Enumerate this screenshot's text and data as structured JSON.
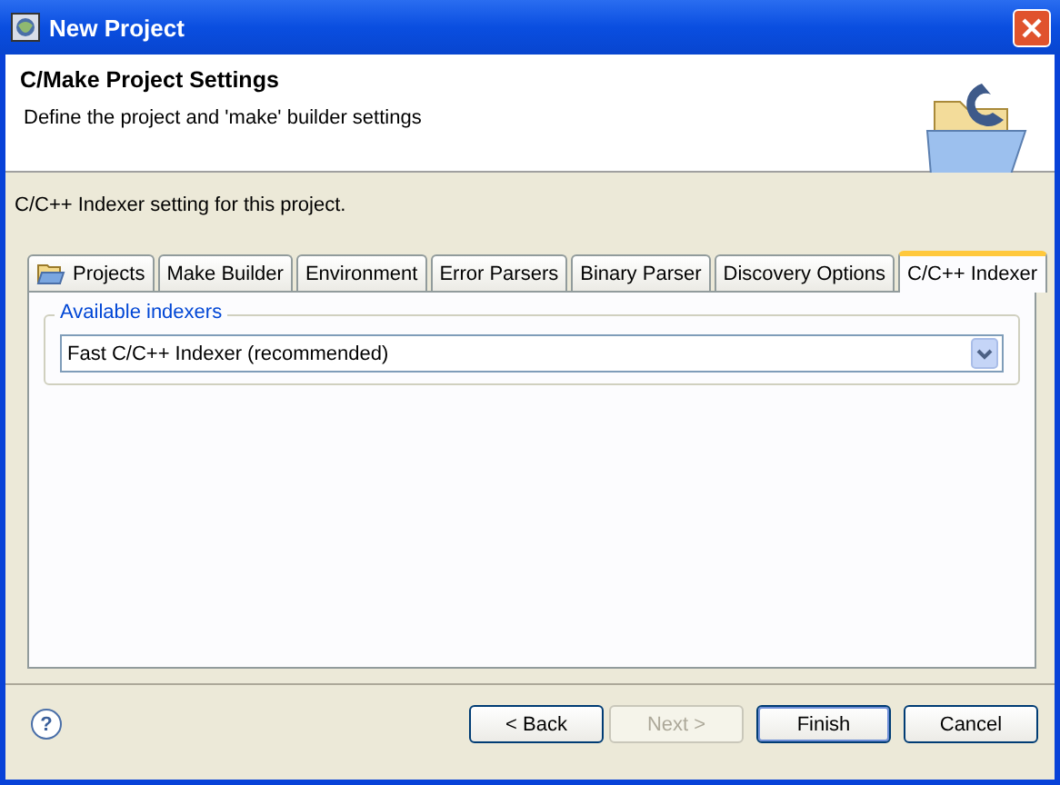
{
  "window": {
    "title": "New Project"
  },
  "header": {
    "title": "C/Make Project Settings",
    "description": "Define the project and 'make' builder settings"
  },
  "message": "C/C++ Indexer setting for this project.",
  "tabs": [
    {
      "label": "Projects",
      "selected": false,
      "icon": true
    },
    {
      "label": "Make Builder",
      "selected": false,
      "icon": false
    },
    {
      "label": "Environment",
      "selected": false,
      "icon": false
    },
    {
      "label": "Error Parsers",
      "selected": false,
      "icon": false
    },
    {
      "label": "Binary Parser",
      "selected": false,
      "icon": false
    },
    {
      "label": "Discovery Options",
      "selected": false,
      "icon": false
    },
    {
      "label": "C/C++ Indexer",
      "selected": true,
      "icon": false
    }
  ],
  "indexers": {
    "label": "Available indexers",
    "value": "Fast C/C++ Indexer (recommended)"
  },
  "help": "?",
  "buttons": [
    {
      "label": "< Back",
      "disabled": false,
      "default": false
    },
    {
      "label": "Next >",
      "disabled": true,
      "default": false
    },
    {
      "label": "Finish",
      "disabled": false,
      "default": true
    },
    {
      "label": "Cancel",
      "disabled": false,
      "default": false
    }
  ]
}
